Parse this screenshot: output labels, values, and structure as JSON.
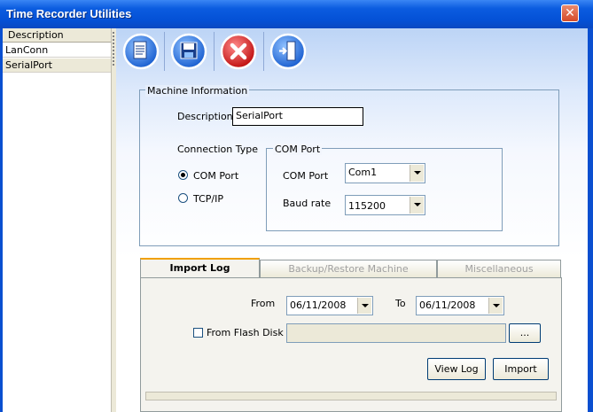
{
  "window": {
    "title": "Time Recorder Utilities",
    "close_symbol": "✕"
  },
  "list": {
    "header": "Description",
    "items": [
      {
        "label": "LanConn",
        "selected": false
      },
      {
        "label": "SerialPort",
        "selected": true
      }
    ]
  },
  "toolbar": {
    "buttons": [
      {
        "icon": "document-icon"
      },
      {
        "icon": "save-icon"
      },
      {
        "icon": "delete-icon"
      },
      {
        "icon": "exit-icon"
      }
    ]
  },
  "machine_info": {
    "legend": "Machine Information",
    "description_label": "Description",
    "description_value": "SerialPort",
    "connection_type_label": "Connection Type",
    "radio_com": "COM Port",
    "radio_tcp": "TCP/IP",
    "selected_connection": "COM Port",
    "com_group": {
      "legend": "COM Port",
      "com_port_label": "COM Port",
      "com_port_value": "Com1",
      "baud_label": "Baud rate",
      "baud_value": "115200"
    }
  },
  "tabs": {
    "items": [
      {
        "label": "Import Log",
        "active": true,
        "enabled": true
      },
      {
        "label": "Backup/Restore Machine",
        "active": false,
        "enabled": false
      },
      {
        "label": "Miscellaneous",
        "active": false,
        "enabled": false
      }
    ],
    "import_log": {
      "from_label": "From",
      "from_value": "06/11/2008",
      "to_label": "To",
      "to_value": "06/11/2008",
      "flash_disk_label": "From Flash Disk",
      "browse_label": "...",
      "view_log_label": "View Log",
      "import_label": "Import"
    }
  },
  "colors": {
    "titlebar": "#0451d6",
    "accent_tab": "#f0a000"
  }
}
